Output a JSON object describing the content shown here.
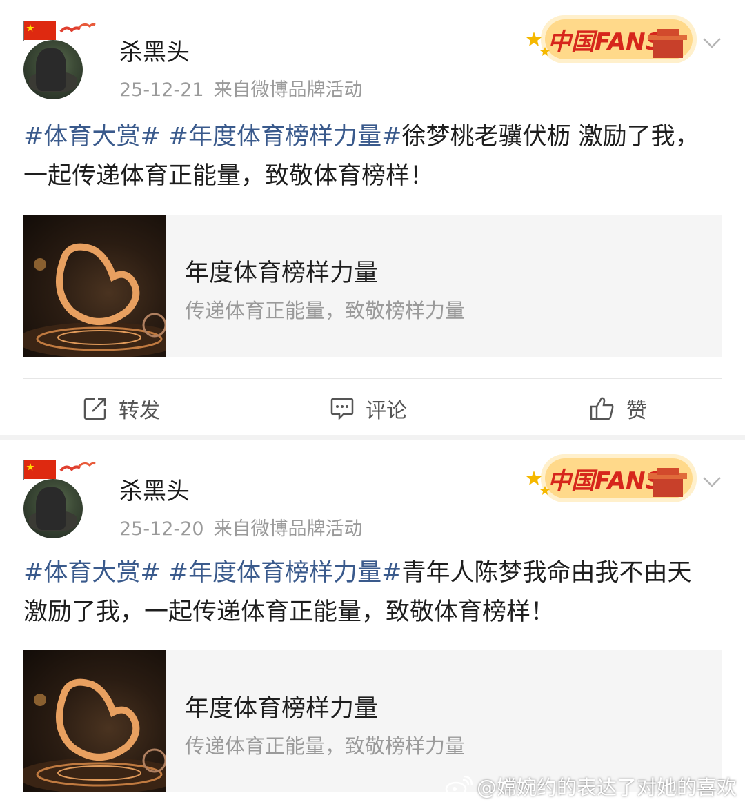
{
  "posts": [
    {
      "username": "杀黑头",
      "date": "25-12-21",
      "source": "来自微博品牌活动",
      "badge_text": "中国FANS",
      "tags": [
        "#体育大赏#",
        "#年度体育榜样力量#"
      ],
      "body": "徐梦桃老骥伏枥 激励了我，一起传递体育正能量，致敬体育榜样！",
      "card": {
        "title": "年度体育榜样力量",
        "subtitle": "传递体育正能量，致敬榜样力量"
      },
      "actions": {
        "repost": "转发",
        "comment": "评论",
        "like": "赞"
      }
    },
    {
      "username": "杀黑头",
      "date": "25-12-20",
      "source": "来自微博品牌活动",
      "badge_text": "中国FANS",
      "tags": [
        "#体育大赏#",
        "#年度体育榜样力量#"
      ],
      "body": "青年人陈梦我命由我不由天 激励了我，一起传递体育正能量，致敬体育榜样！",
      "card": {
        "title": "年度体育榜样力量",
        "subtitle": "传递体育正能量，致敬榜样力量"
      }
    }
  ],
  "watermark": "@嫦婉约的表达了对她的喜欢",
  "colors": {
    "tag": "#3a5a8c",
    "meta": "#9a9a9a",
    "badge": "#f5a623"
  }
}
